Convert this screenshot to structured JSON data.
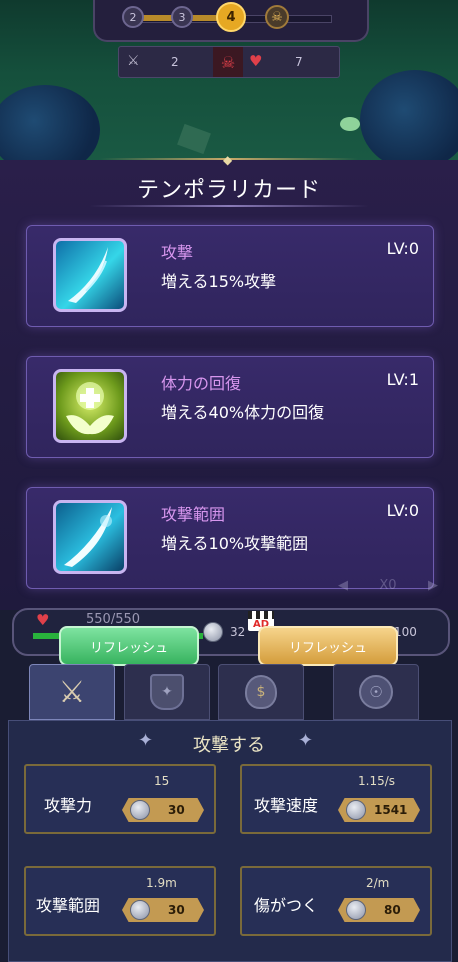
{
  "stage_progress": {
    "stages": [
      "2",
      "3",
      "4"
    ],
    "current_stage": "4"
  },
  "battle_stats": {
    "kills": "2",
    "lives": "7"
  },
  "panel": {
    "title": "テンポラリカード"
  },
  "cards": [
    {
      "name": "攻撃",
      "level": "LV:0",
      "description": "増える15%攻撃",
      "icon": "slash-icon"
    },
    {
      "name": "体力の回復",
      "level": "LV:1",
      "description": "増える40%体力の回復",
      "icon": "heal-hands-icon"
    },
    {
      "name": "攻撃範囲",
      "level": "LV:0",
      "description": "増える10%攻撃範囲",
      "icon": "range-slash-icon"
    }
  ],
  "reroll_counter": "X0",
  "player": {
    "hp": "550/550",
    "hp_fraction": 1.0,
    "coins": "32",
    "gems": "100"
  },
  "refresh_buttons": {
    "free_label": "リフレッシュ",
    "ad_label": "リフレッシュ",
    "ad_badge": "AD"
  },
  "tabs": [
    {
      "icon": "crossed-swords-icon",
      "active": true
    },
    {
      "icon": "shield-wheat-icon",
      "active": false
    },
    {
      "icon": "money-bag-icon",
      "active": false
    },
    {
      "icon": "hero-icon",
      "active": false
    }
  ],
  "upgrade_section": {
    "title": "攻撃する",
    "items": [
      {
        "name": "攻撃力",
        "value": "15",
        "cost": "30"
      },
      {
        "name": "攻撃速度",
        "value": "1.15/s",
        "cost": "1541"
      },
      {
        "name": "攻撃範囲",
        "value": "1.9m",
        "cost": "30"
      },
      {
        "name": "傷がつく",
        "value": "2/m",
        "cost": "80"
      }
    ]
  },
  "colors": {
    "card_name": "#d796ee",
    "free_button": "#37b35f",
    "ad_button": "#d49d3c",
    "hp_bar": "#29b23c"
  }
}
